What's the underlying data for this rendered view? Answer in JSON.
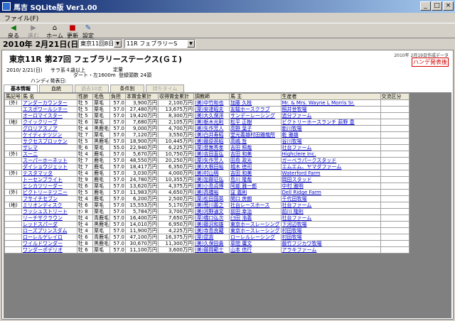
{
  "window": {
    "title": "馬吉 SQLite版 Ver1.00"
  },
  "menu": {
    "file": "ファイル(F)"
  },
  "toolbar": {
    "back": "戻る",
    "forward": "進む",
    "home": "ホーム",
    "refresh": "更新",
    "settings": "設定"
  },
  "datebar": {
    "date": "2010年 2月21日(日)",
    "course_select": "東京11回8日",
    "race_select": "11R フェブラリーS"
  },
  "race": {
    "title": "東京11R 第27回 フェブラリーステークス(ＧＩ)",
    "created": "2010年 2月19日作成データ",
    "handicap_badge": "ハンデ発表後",
    "date": "2010/ 2/21(日)",
    "class": "サラ系４歳以上",
    "cond": "定量",
    "track": "ダート・左1600m",
    "count": "登録頭数 24頭",
    "handicap": "ハンディ発表日:"
  },
  "tabs": [
    "基本情報",
    "血統",
    "過去10走",
    "条件別",
    "持ちタイム"
  ],
  "table": {
    "headers": [
      "馬記号",
      "馬 名",
      "性齢",
      "毛色",
      "負担",
      "本賞金累計",
      "収得賞金累計",
      "調教師",
      "馬 主",
      "生産者",
      "交流区分"
    ],
    "rows": [
      [
        "(外)",
        "アンダーカウンター",
        "牡 5",
        "栗毛",
        "57.0",
        "3,900万円",
        "2,100万円",
        "(美)中竹和也",
        "加藤 久枝",
        "Mr. & Mrs. Wayne L Morris Sr.",
        ""
      ],
      [
        "",
        "エスポワールシチー",
        "牡 5",
        "栗毛",
        "57.0",
        "27,480万円",
        "13,675万円",
        "(栗)安達昭夫",
        "友駿ホースクラブ",
        "照井世牧場",
        ""
      ],
      [
        "",
        "オーロマイスター",
        "牡 5",
        "栗毛",
        "57.0",
        "19,420万円",
        "8,300万円",
        "(美)大久保洋",
        "サンデーレーシング",
        "追分ファーム",
        ""
      ],
      [
        "(地)",
        "クイックリーブ",
        "牡 6",
        "栗毛",
        "57.0",
        "7,680万円",
        "2,105万円",
        "(美)栃木光則",
        "松平 正樹",
        "ビクトリーホースランチ 荻野 豊",
        ""
      ],
      [
        "",
        "グロリアスノア",
        "牡 4",
        "黒鹿毛",
        "57.0",
        "9,000万円",
        "4,700万円",
        "(美)矢作芳人",
        "高野 葉子",
        "新川牧場",
        ""
      ],
      [
        "",
        "ケイディテツジン",
        "牡 7",
        "栗毛",
        "57.0",
        "7,120万円",
        "3,550万円",
        "(美)白井寿昭",
        "堂光義雄村田雅哉所",
        "乾 雅雄",
        ""
      ],
      [
        "",
        "サクセスブロッケン",
        "牡 5",
        "黒鹿毛",
        "57.0",
        "18,900万円",
        "10,445万円",
        "(美)藤原英昭",
        "高嶋 哲",
        "谷川牧場",
        ""
      ],
      [
        "",
        "ザレマ",
        "牝 6",
        "栗毛",
        "55.0",
        "22,940万円",
        "6,225万円",
        "(栗)音無秀孝",
        "吉田 照哉",
        "社台ファーム",
        ""
      ],
      [
        "(外)",
        "スーニ",
        "牡 4",
        "鹿毛",
        "57.0",
        "5,670万円",
        "10,750万円",
        "(美)吉田直弘",
        "吉田 和美",
        "Highclere Inc.",
        ""
      ],
      [
        "",
        "スーパーホーネット",
        "牡 7",
        "鹿毛",
        "57.0",
        "48,550万円",
        "20,250万円",
        "(栗)矢作芳人",
        "田島 政光",
        "ガーベラパークスタッド",
        ""
      ],
      [
        "",
        "ダイショウジェット",
        "牡 7",
        "鹿毛",
        "57.0",
        "18,417万円",
        "6,350万円",
        "(美)大根田裕",
        "城木 徳司",
        "エムエム、ヤマダファーム",
        ""
      ],
      [
        "(外)",
        "テスタマッタ",
        "牡 4",
        "鹿毛",
        "57.0",
        "3,030万円",
        "4,000万円",
        "(美)村山明",
        "吉田 和美",
        "Waterford Farm",
        ""
      ],
      [
        "",
        "トーセンブライト",
        "牡 9",
        "鹿毛",
        "57.0",
        "24,780万円",
        "10,355万円",
        "(美)加藤征弘",
        "島川 隆哉",
        "岡田スタッド",
        ""
      ],
      [
        "",
        "ヒシカツリーダー",
        "牡 6",
        "栗毛",
        "57.0",
        "13,620万円",
        "4,375万円",
        "(美)小島貞博",
        "阿部 雅一郎",
        "中村 雅明",
        ""
      ],
      [
        "(外)",
        "ビクトリーテツニー",
        "牡 5",
        "鹿毛",
        "57.0",
        "11,983万円",
        "4,650万円",
        "(美)高橋裕",
        "窪 義則",
        "Dell Ridge Farm",
        ""
      ],
      [
        "",
        "フサイチセブン",
        "牡 4",
        "鹿毛",
        "57.0",
        "6,200万円",
        "2,500万円",
        "(栗)松田国英",
        "関口 房朗",
        "千代田牧場",
        ""
      ],
      [
        "(地)",
        "ミリオンディスク",
        "牡 6",
        "栗毛",
        "57.0",
        "15,553万円",
        "5,170万円",
        "(美)荒川義之",
        "社台レースホース",
        "社台ファーム",
        ""
      ],
      [
        "",
        "ラッシュストリート",
        "ｾﾝ 8",
        "栗毛",
        "57.0",
        "5,784万円",
        "3,700万円",
        "(美)河野通文",
        "前田 幸治",
        "前川 隆則",
        ""
      ],
      [
        "",
        "リーチザクラウン",
        "牡 4",
        "青鹿毛",
        "57.0",
        "16,400万円",
        "7,650万円",
        "(栗)橋口弘次",
        "臼田 浩義",
        "社台ファーム",
        ""
      ],
      [
        "",
        "レッドスパーダ",
        "牡 4",
        "黒鹿毛",
        "57.0",
        "14,010万円",
        "6,950万円",
        "(美)藤沢和雄",
        "東京ホースレーシング",
        "下河辺牧場",
        ""
      ],
      [
        "",
        "ローズプリンスダム",
        "牡 4",
        "栗毛",
        "57.0",
        "11,900万円",
        "4,225万円",
        "(美)寺島良蔵",
        "東京ホースレーシング",
        "村田牧場",
        ""
      ],
      [
        "",
        "ローレルゲレイロ",
        "牡 6",
        "青鹿毛",
        "57.0",
        "47,100万円",
        "16,375万円",
        "(栗)昆貢",
        "ローレルレーシング",
        "村田牧場",
        ""
      ],
      [
        "",
        "ワイルドワンダー",
        "牡 8",
        "黒鹿毛",
        "57.0",
        "30,670万円",
        "11,300万円",
        "(美)久保田貴",
        "草間 庸文",
        "藤竹フジカワ牧場",
        ""
      ],
      [
        "",
        "ワンダーポデリオ",
        "牡 6",
        "栗毛",
        "57.0",
        "11,100万円",
        "3,600万円",
        "(美)藤岡範士",
        "山本 信行",
        "アラキファーム",
        ""
      ]
    ]
  }
}
